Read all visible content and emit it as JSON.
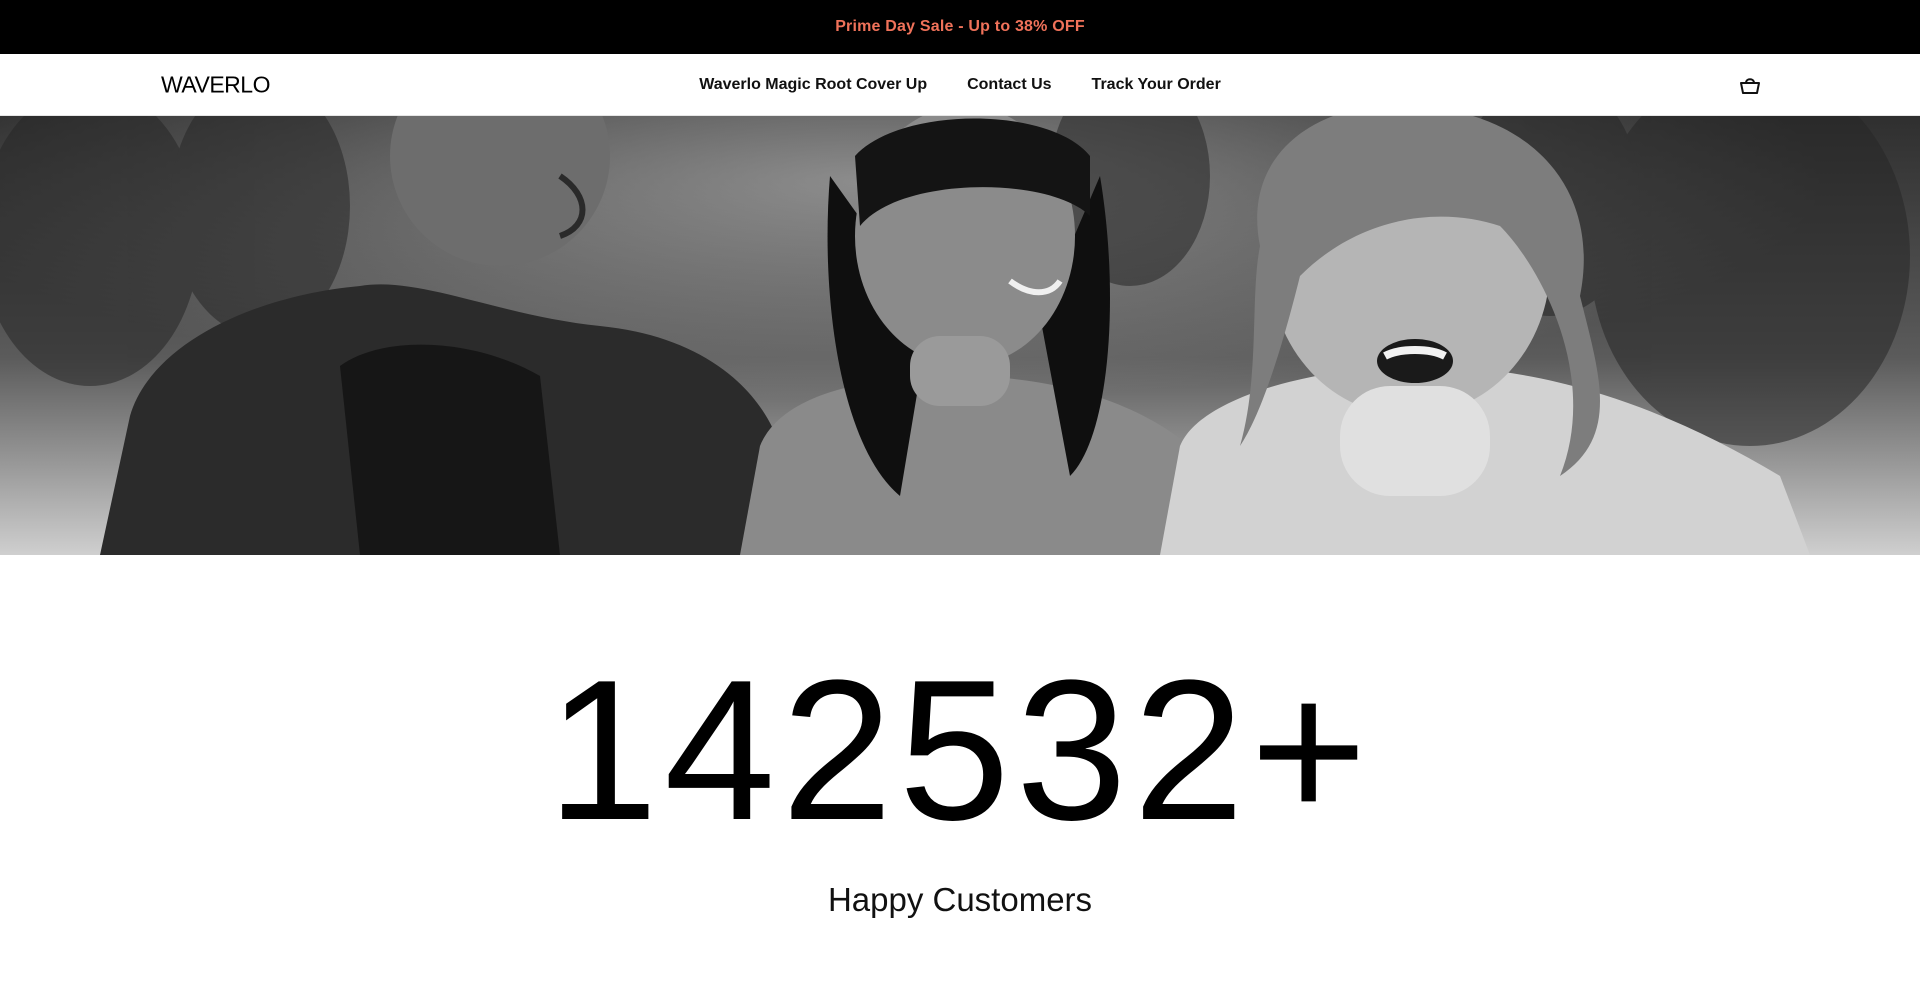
{
  "announcement": {
    "text": "Prime Day Sale - Up to 38% OFF",
    "color": "#f0725a"
  },
  "header": {
    "logo": "WAVERLO",
    "nav": [
      {
        "label": "Waverlo Magic Root Cover Up"
      },
      {
        "label": "Contact Us"
      },
      {
        "label": "Track Your Order"
      }
    ],
    "cart_icon": "cart-basket-icon"
  },
  "hero": {
    "image": "black-and-white-photo-three-people-smiling-outdoors"
  },
  "stats": {
    "number": "142532+",
    "label": "Happy Customers"
  }
}
